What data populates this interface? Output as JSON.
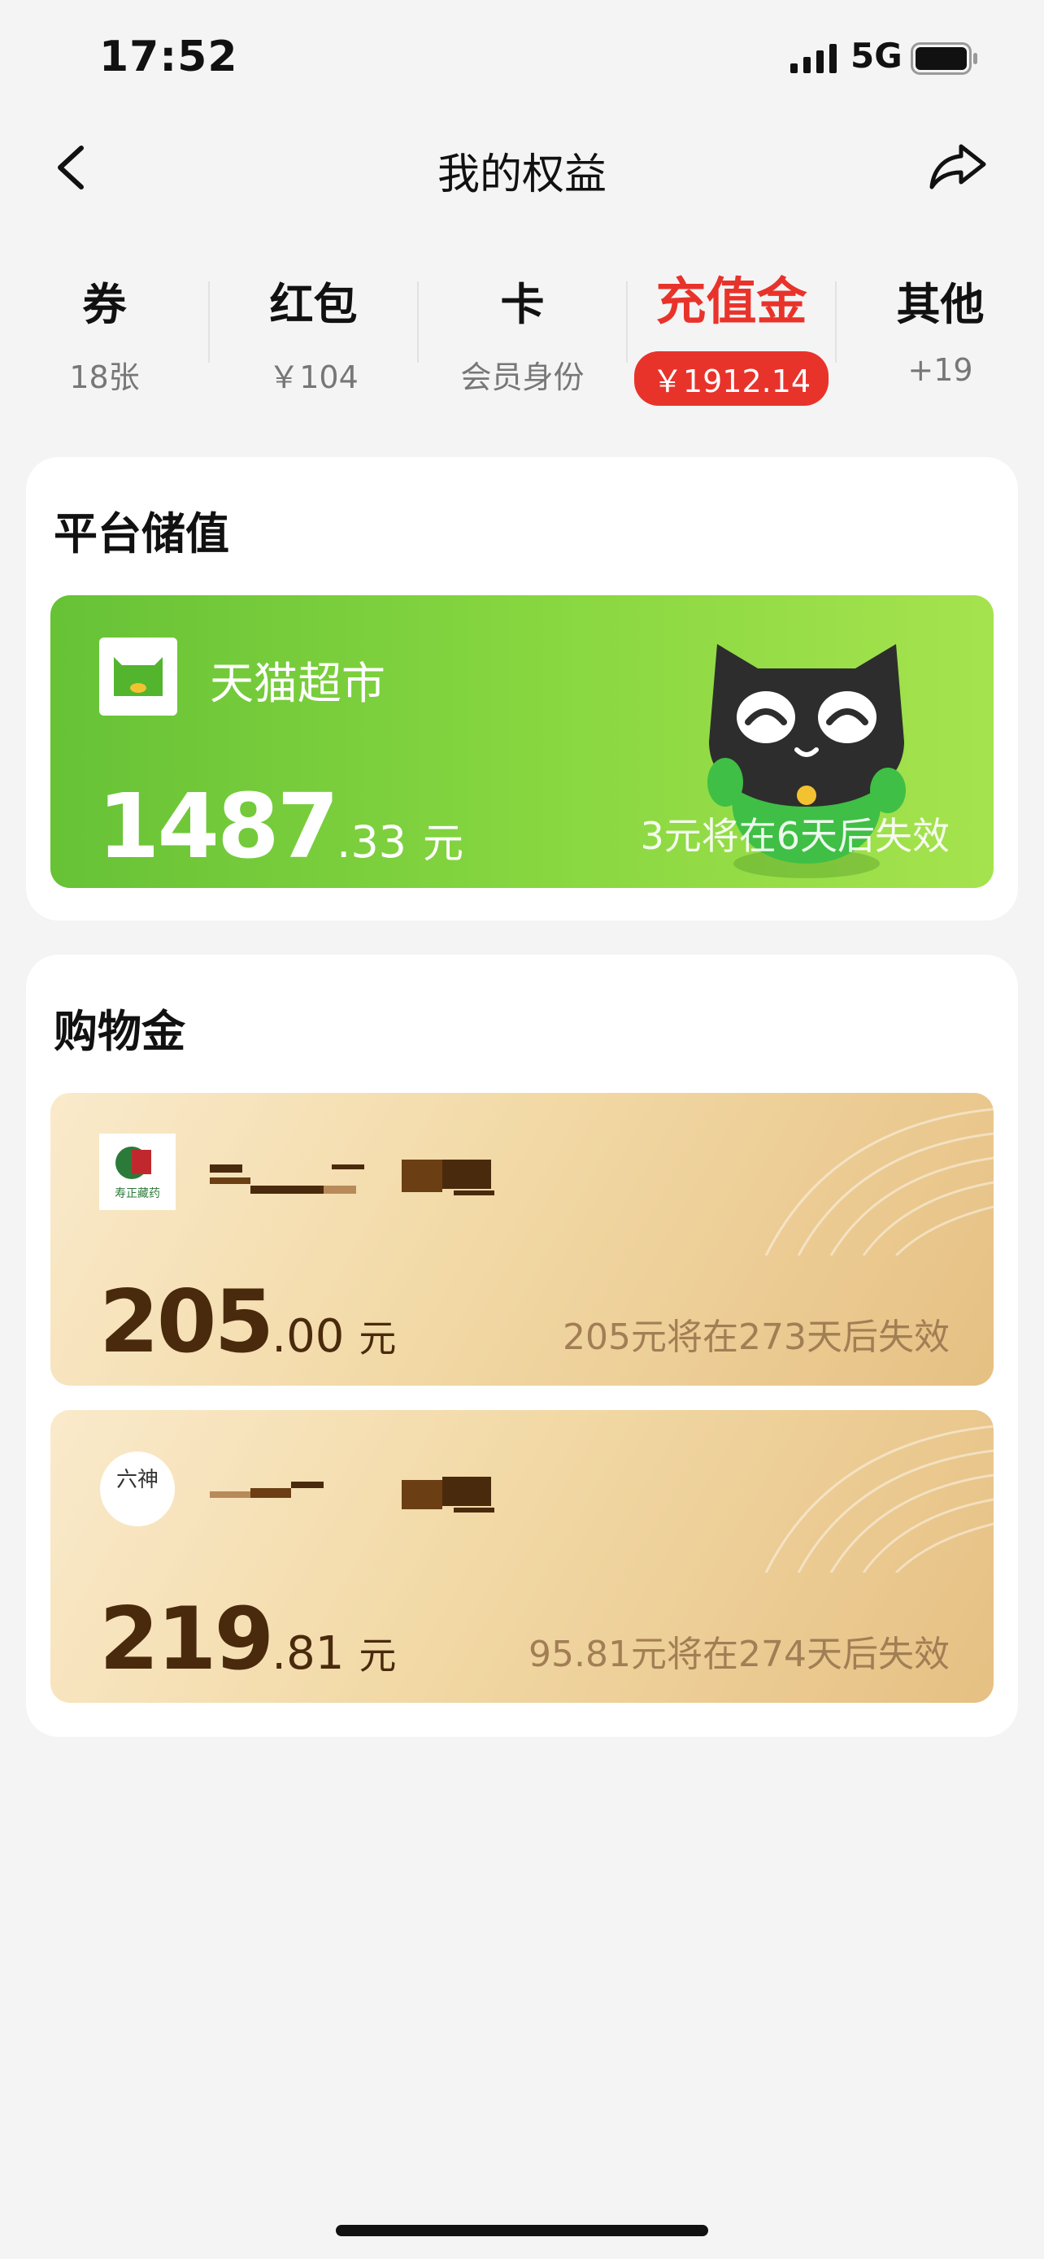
{
  "status_bar": {
    "time": "17:52",
    "network": "5G"
  },
  "nav": {
    "title": "我的权益"
  },
  "tabs": [
    {
      "label": "券",
      "sub": "18张"
    },
    {
      "label": "红包",
      "sub": "￥104"
    },
    {
      "label": "卡",
      "sub": "会员身份"
    },
    {
      "label": "充值金",
      "sub": "￥1912.14",
      "active": true
    },
    {
      "label": "其他",
      "sub": "+19"
    }
  ],
  "platform_section": {
    "title": "平台储值",
    "card": {
      "store_name": "天猫超市",
      "amount_int": "1487",
      "amount_dec": ".33",
      "unit": "元",
      "expiry": "3元将在6天后失效"
    }
  },
  "shopping_section": {
    "title": "购物金",
    "cards": [
      {
        "logo_text": "寿正藏药",
        "amount_int": "205",
        "amount_dec": ".00",
        "unit": "元",
        "expiry": "205元将在273天后失效"
      },
      {
        "logo_text": "六神",
        "amount_int": "219",
        "amount_dec": ".81",
        "unit": "元",
        "expiry": "95.81元将在274天后失效"
      }
    ]
  },
  "colors": {
    "accent_red": "#e8332b",
    "tmall_green": "#7ccd3c",
    "gold": "#f2d9a6"
  },
  "icons": [
    "back-arrow-icon",
    "share-icon",
    "signal-icon",
    "battery-icon",
    "tmall-logo-icon",
    "store-logo-icon"
  ]
}
